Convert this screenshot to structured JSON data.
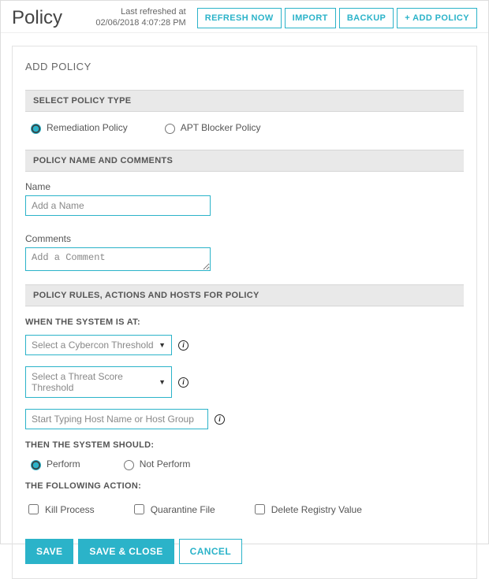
{
  "header": {
    "title": "Policy",
    "refreshed_label": "Last refreshed at",
    "refreshed_time": "02/06/2018 4:07:28 PM",
    "buttons": {
      "refresh": "REFRESH NOW",
      "import": "IMPORT",
      "backup": "BACKUP",
      "add": "+ ADD POLICY"
    }
  },
  "panel": {
    "title": "ADD POLICY",
    "sections": {
      "type_header": "SELECT POLICY TYPE",
      "type_radios": {
        "remediation": "Remediation Policy",
        "apt": "APT Blocker Policy"
      },
      "name_header": "POLICY NAME AND COMMENTS",
      "name_label": "Name",
      "name_placeholder": "Add a Name",
      "comments_label": "Comments",
      "comments_placeholder": "Add a Comment",
      "rules_header": "POLICY RULES, ACTIONS AND HOSTS FOR POLICY",
      "when_label": "WHEN THE SYSTEM IS AT:",
      "sel_cybercon": "Select a Cybercon Threshold",
      "sel_threat": "Select a Threat Score Threshold",
      "host_placeholder": "Start Typing Host Name or Host Group",
      "then_label": "THEN THE SYSTEM SHOULD:",
      "perform_radios": {
        "perform": "Perform",
        "not_perform": "Not Perform"
      },
      "action_label": "THE FOLLOWING ACTION:",
      "actions": {
        "kill": "Kill Process",
        "quarantine": "Quarantine File",
        "delete_reg": "Delete Registry Value"
      }
    },
    "buttons": {
      "save": "SAVE",
      "save_close": "SAVE & CLOSE",
      "cancel": "CANCEL"
    }
  }
}
